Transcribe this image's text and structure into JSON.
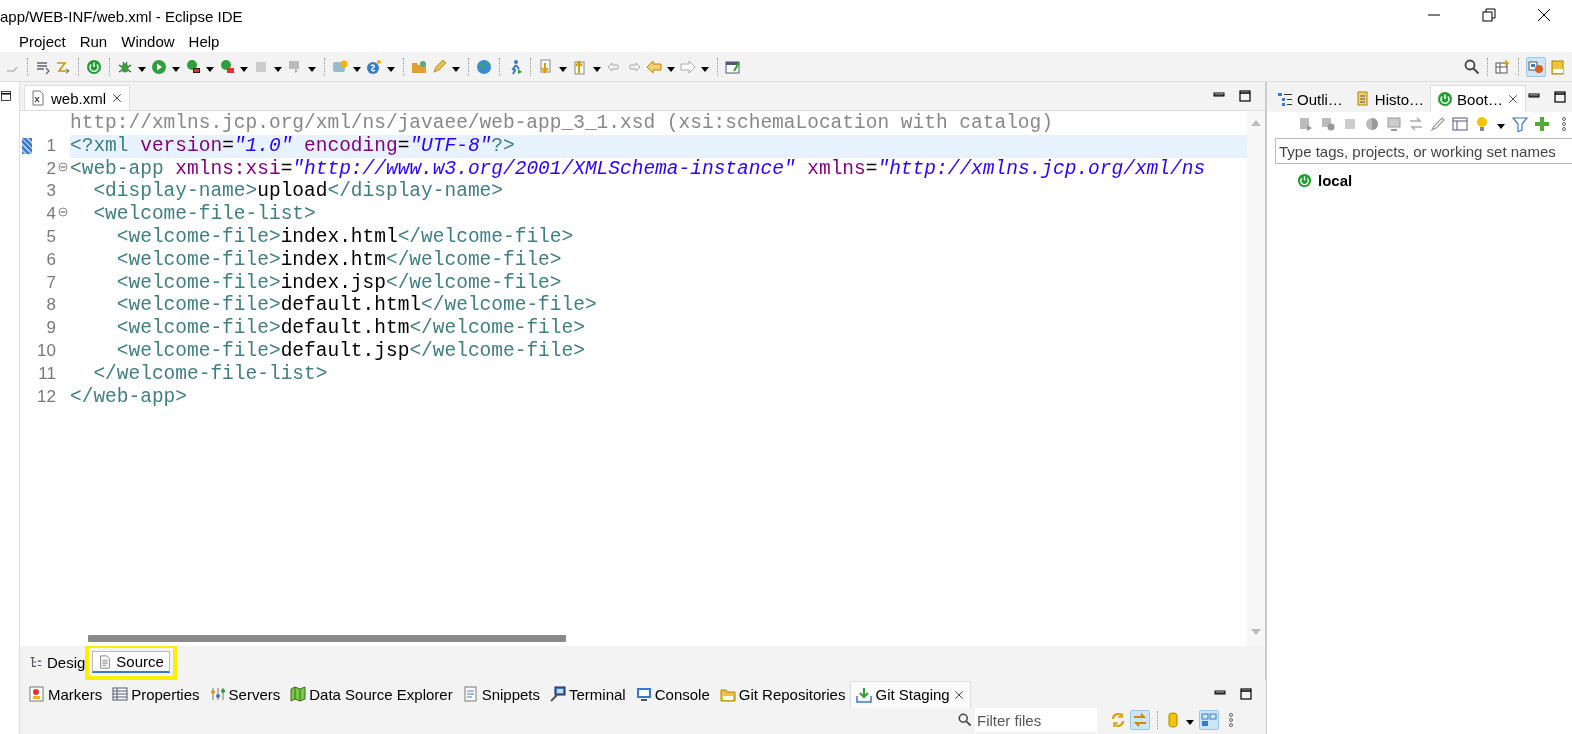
{
  "window": {
    "title": "app/WEB-INF/web.xml - Eclipse IDE"
  },
  "menu": [
    "Project",
    "Run",
    "Window",
    "Help"
  ],
  "editor": {
    "tabs": [
      {
        "label": "web.xml",
        "selected": true
      }
    ],
    "schema_hint": "http://xmlns.jcp.org/xml/ns/javaee/web-app_3_1.xsd (xsi:schemaLocation with catalog)",
    "lines": [
      {
        "number": "1",
        "current": true,
        "fold_marker": false,
        "tokens": [
          {
            "kind": "tag",
            "text": "<?xml"
          },
          {
            "kind": "attr",
            "text": " version"
          },
          {
            "kind": "text",
            "text": "="
          },
          {
            "kind": "value",
            "text": "\"1.0\""
          },
          {
            "kind": "attr",
            "text": " encoding"
          },
          {
            "kind": "text",
            "text": "="
          },
          {
            "kind": "value",
            "text": "\"UTF-8\""
          },
          {
            "kind": "tag",
            "text": "?>"
          }
        ]
      },
      {
        "number": "2",
        "current": false,
        "fold_marker": true,
        "tokens": [
          {
            "kind": "tag",
            "text": "<web-app"
          },
          {
            "kind": "attr",
            "text": " xmlns:xsi"
          },
          {
            "kind": "text",
            "text": "="
          },
          {
            "kind": "value",
            "text": "\"http://www.w3.org/2001/XMLSchema-instance\""
          },
          {
            "kind": "attr",
            "text": " xmlns"
          },
          {
            "kind": "text",
            "text": "="
          },
          {
            "kind": "value",
            "text": "\"http://xmlns.jcp.org/xml/ns"
          }
        ]
      },
      {
        "number": "3",
        "current": false,
        "fold_marker": false,
        "tokens": [
          {
            "kind": "tag",
            "text": "  <display-name>"
          },
          {
            "kind": "text",
            "text": "upload"
          },
          {
            "kind": "tag",
            "text": "</display-name>"
          }
        ]
      },
      {
        "number": "4",
        "current": false,
        "fold_marker": true,
        "tokens": [
          {
            "kind": "tag",
            "text": "  <welcome-file-list>"
          }
        ]
      },
      {
        "number": "5",
        "current": false,
        "fold_marker": false,
        "tokens": [
          {
            "kind": "tag",
            "text": "    <welcome-file>"
          },
          {
            "kind": "text",
            "text": "index.html"
          },
          {
            "kind": "tag",
            "text": "</welcome-file>"
          }
        ]
      },
      {
        "number": "6",
        "current": false,
        "fold_marker": false,
        "tokens": [
          {
            "kind": "tag",
            "text": "    <welcome-file>"
          },
          {
            "kind": "text",
            "text": "index.htm"
          },
          {
            "kind": "tag",
            "text": "</welcome-file>"
          }
        ]
      },
      {
        "number": "7",
        "current": false,
        "fold_marker": false,
        "tokens": [
          {
            "kind": "tag",
            "text": "    <welcome-file>"
          },
          {
            "kind": "text",
            "text": "index.jsp"
          },
          {
            "kind": "tag",
            "text": "</welcome-file>"
          }
        ]
      },
      {
        "number": "8",
        "current": false,
        "fold_marker": false,
        "tokens": [
          {
            "kind": "tag",
            "text": "    <welcome-file>"
          },
          {
            "kind": "text",
            "text": "default.html"
          },
          {
            "kind": "tag",
            "text": "</welcome-file>"
          }
        ]
      },
      {
        "number": "9",
        "current": false,
        "fold_marker": false,
        "tokens": [
          {
            "kind": "tag",
            "text": "    <welcome-file>"
          },
          {
            "kind": "text",
            "text": "default.htm"
          },
          {
            "kind": "tag",
            "text": "</welcome-file>"
          }
        ]
      },
      {
        "number": "10",
        "current": false,
        "fold_marker": false,
        "tokens": [
          {
            "kind": "tag",
            "text": "    <welcome-file>"
          },
          {
            "kind": "text",
            "text": "default.jsp"
          },
          {
            "kind": "tag",
            "text": "</welcome-file>"
          }
        ]
      },
      {
        "number": "11",
        "current": false,
        "fold_marker": false,
        "tokens": [
          {
            "kind": "tag",
            "text": "  </welcome-file-list>"
          }
        ]
      },
      {
        "number": "12",
        "current": false,
        "fold_marker": false,
        "tokens": [
          {
            "kind": "tag",
            "text": "</web-app>"
          }
        ]
      }
    ],
    "bottom_tabs": [
      {
        "label": "Desig",
        "selected": false,
        "highlighted": false
      },
      {
        "label": "Source",
        "selected": true,
        "highlighted": true
      }
    ]
  },
  "side_panel": {
    "tabs": [
      {
        "label": "Outli…",
        "selected": false
      },
      {
        "label": "Histo…",
        "selected": false
      },
      {
        "label": "Boot…",
        "selected": true
      }
    ],
    "search": {
      "placeholder": "Type tags, projects, or working set names"
    },
    "tree": [
      {
        "label": "local"
      }
    ]
  },
  "bottom_panel": {
    "tabs": [
      {
        "label": "Markers",
        "selected": false
      },
      {
        "label": "Properties",
        "selected": false
      },
      {
        "label": "Servers",
        "selected": false
      },
      {
        "label": "Data Source Explorer",
        "selected": false
      },
      {
        "label": "Snippets",
        "selected": false
      },
      {
        "label": "Terminal",
        "selected": false
      },
      {
        "label": "Console",
        "selected": false
      },
      {
        "label": "Git Repositories",
        "selected": false
      },
      {
        "label": "Git Staging",
        "selected": true
      }
    ],
    "filter": {
      "placeholder": "Filter files"
    }
  }
}
